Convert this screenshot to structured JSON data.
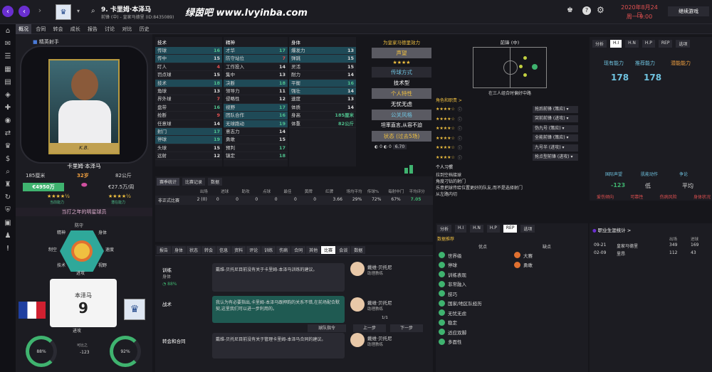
{
  "header": {
    "title": "9. 卡里姆·本泽马",
    "subtitle": "前锋 (中) - 皇家马德里 (ID:8435089)",
    "date": "2020年8月24日",
    "time": "周一 9:00",
    "continue": "继续游戏",
    "brand": "绿茵吧 www.lvyinba.com"
  },
  "tabs": [
    "概况",
    "合同",
    "转会",
    "成长",
    "报告",
    "讨论",
    "对比",
    "历史"
  ],
  "left": {
    "badge": "精英射手",
    "player_name": "卡里姆·本泽马",
    "height": "185厘米",
    "age": "32岁",
    "weight": "82公斤",
    "value": "€4950万",
    "wage": "€27.5万/周",
    "cur_ability": "当前能力",
    "pot_ability": "潜在能力",
    "best_label": "当打之年的明星球员",
    "shirt_name": "本泽马",
    "shirt_number": "9",
    "kit_label": "进攻",
    "pitch_labels": [
      "防守",
      "精神",
      "身体",
      "制空",
      "速度",
      "技术",
      "视野",
      "进攻"
    ],
    "rings": [
      {
        "value": "88%",
        "label": "训练"
      },
      {
        "value": "92%",
        "label": "比赛状态"
      }
    ],
    "mid_text": "可比之",
    "mid_value": "-123"
  },
  "tech": {
    "title": "技术",
    "rows": [
      [
        "传球",
        "16"
      ],
      [
        "传中",
        "15"
      ],
      [
        "盯人",
        "4"
      ],
      [
        "罚点球",
        "15"
      ],
      [
        "技术",
        "18"
      ],
      [
        "角球",
        "13"
      ],
      [
        "界外球",
        "7"
      ],
      [
        "盘带",
        "16"
      ],
      [
        "抢断",
        "9"
      ],
      [
        "任意球",
        "14"
      ],
      [
        "射门",
        "17"
      ],
      [
        "停球",
        "19"
      ],
      [
        "头球",
        "15"
      ],
      [
        "远射",
        "12"
      ]
    ]
  },
  "mental": {
    "title": "精神",
    "rows": [
      [
        "才华",
        "17"
      ],
      [
        "防守站位",
        "7"
      ],
      [
        "工作投入",
        "14"
      ],
      [
        "集中",
        "13"
      ],
      [
        "决断",
        "18"
      ],
      [
        "领导力",
        "11"
      ],
      [
        "侵略性",
        "12"
      ],
      [
        "视野",
        "17"
      ],
      [
        "团队合作",
        "16"
      ],
      [
        "无球跑动",
        "19"
      ],
      [
        "意志力",
        "14"
      ],
      [
        "勇敢",
        "15"
      ],
      [
        "预判",
        "17"
      ],
      [
        "镇定",
        "18"
      ]
    ]
  },
  "physical": {
    "title": "身体",
    "rows": [
      [
        "爆发力",
        "13"
      ],
      [
        "弹跳",
        "15"
      ],
      [
        "灵活",
        "15"
      ],
      [
        "耐力",
        "14"
      ],
      [
        "平衡",
        "16"
      ],
      [
        "强壮",
        "14"
      ],
      [
        "速度",
        "13"
      ],
      [
        "体质",
        "14"
      ],
      [
        "身高",
        "185厘米"
      ],
      [
        "体重",
        "82公斤"
      ]
    ]
  },
  "personality": {
    "title": "为皇家马德里效力",
    "items": [
      "声望",
      "传球方式",
      "技术型",
      "个人特性",
      "无忧无虑",
      "公关风格",
      "坦率直言,从容不迫",
      "状态 (过去5场)"
    ],
    "rating": "6.70"
  },
  "pitch": {
    "title": "前锋 (中)",
    "note": "在三人组合时偏好中路"
  },
  "roles": {
    "title": "角色和职责 >",
    "rows": [
      [
        "抢后前锋 (策应)"
      ],
      [
        "突前前锋 (进攻)"
      ],
      [
        "伪九号 (策应)"
      ],
      [
        "全能前锋 (策应)"
      ],
      [
        "九号半 (进攻)"
      ],
      [
        "抢点型前锋 (进攻)"
      ]
    ]
  },
  "preferred": {
    "title": "个人习惯",
    "items": [
      "拉到空档接球",
      "角度刁钻的射门",
      "乐意把球传给位置更好的队友,而不是选择射门",
      "从左路内切"
    ]
  },
  "ability_panel": {
    "tabs": [
      "分析",
      "H.I",
      "H.N",
      "H.P",
      "REP",
      "选项"
    ],
    "col1": "现有能力",
    "col2": "推荐能力",
    "col3": "潜能能力",
    "v1": "178",
    "v2": "178",
    "labels": [
      "国际声望",
      "肌能动作",
      "争论"
    ],
    "values": [
      "-123",
      "低",
      "平均"
    ],
    "bottom": [
      "爱伤倾向",
      "可靠性",
      "伤病风险",
      "身体状况"
    ]
  },
  "stats": {
    "tabs": [
      "赛季统计",
      "比赛记录",
      "数据"
    ],
    "header": [
      "",
      "出场",
      "进球",
      "助攻",
      "点球",
      "最佳",
      "黄牌",
      "红牌",
      "场均平均",
      "传球%",
      "每射中门",
      "平均评分"
    ],
    "row": [
      "非正式比赛",
      "2 (0)",
      "0",
      "0",
      "0",
      "0",
      "0",
      "0",
      "3.66",
      "29%",
      "72%",
      "67%",
      "7.05"
    ]
  },
  "coach": {
    "tabs": [
      "报告",
      "身体",
      "状态",
      "转会",
      "信息",
      "资料",
      "评论",
      "训练",
      "伤病",
      "合同",
      "其他",
      "比赛",
      "会谈",
      "数据"
    ],
    "sections": [
      {
        "title": "训练",
        "sub": "身体",
        "pct": "88%",
        "msg": "戴维-贝托尼目前没有关于卡里姆-本泽马训练的建议。",
        "author": "戴维·贝托尼",
        "role": "助理教练"
      },
      {
        "title": "战术",
        "msg": "我认为有必要指出,卡里姆-本泽马跟押韵的关系不错,在前场配合默契,这里我们可以进一步利用的。",
        "author": "戴维·贝托尼",
        "role": "助理教练"
      },
      {
        "title": "转会和合同",
        "msg": "戴维-贝托尼目前没有关于管理卡里姆-本泽马合同的建议。",
        "author": "戴维·贝托尼",
        "role": "助理教练"
      }
    ],
    "prev": "上一步",
    "next": "下一步",
    "page": "1/1",
    "btn": "球队指令"
  },
  "traits": {
    "tabs": [
      "分析",
      "H.I",
      "H.N",
      "H.P",
      "REP",
      "选项"
    ],
    "title": "职业生涯统计",
    "rows": [
      [
        "09-21",
        "皇家马德里",
        "349",
        "169"
      ],
      [
        "02-09",
        "里昂",
        "112",
        "43"
      ]
    ],
    "head": [
      "出场",
      "进球"
    ],
    "good": [
      "世界级",
      "停球",
      "训练表现",
      "非常融入",
      "技巧",
      "国家/地区队经历",
      "无忧无虑",
      "稳定",
      "适应双脚",
      "多面性"
    ],
    "bad": [
      "大赛",
      "勇敢"
    ],
    "good_label": "优点",
    "bad_label": "缺点",
    "list_label": "数据推荐"
  }
}
